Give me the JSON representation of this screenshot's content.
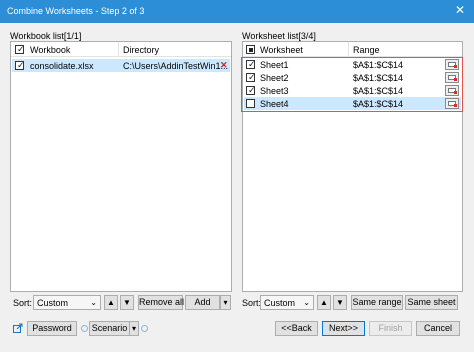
{
  "window": {
    "title": "Combine Worksheets - Step 2 of 3",
    "close_glyph": "✕"
  },
  "workbook_panel": {
    "label": "Workbook list[1/1]",
    "columns": [
      "Workbook",
      "Directory"
    ],
    "rows": [
      {
        "name": "consolidate.xlsx",
        "directory": "C:\\Users\\AddinTestWin1...",
        "checked": true
      }
    ],
    "sort_label": "Sort:",
    "sort_value": "Custom",
    "up_glyph": "▲",
    "down_glyph": "▼",
    "remove_all": "Remove all",
    "add": "Add"
  },
  "worksheet_panel": {
    "label": "Worksheet list[3/4]",
    "columns": [
      "Worksheet",
      "Range"
    ],
    "rows": [
      {
        "name": "Sheet1",
        "range": "$A$1:$C$14",
        "checked": true
      },
      {
        "name": "Sheet2",
        "range": "$A$1:$C$14",
        "checked": true
      },
      {
        "name": "Sheet3",
        "range": "$A$1:$C$14",
        "checked": true
      },
      {
        "name": "Sheet4",
        "range": "$A$1:$C$14",
        "checked": false
      }
    ],
    "sort_label": "Sort:",
    "sort_value": "Custom",
    "same_range": "Same range",
    "same_sheet": "Same sheet"
  },
  "footer": {
    "password": "Password",
    "scenario": "Scenario",
    "back": "<<Back",
    "next": "Next>>",
    "finish": "Finish",
    "cancel": "Cancel"
  },
  "colors": {
    "titlebar": "#2b8ed6",
    "selected_row": "#cce8ff",
    "highlight_frame": "#e25050"
  }
}
